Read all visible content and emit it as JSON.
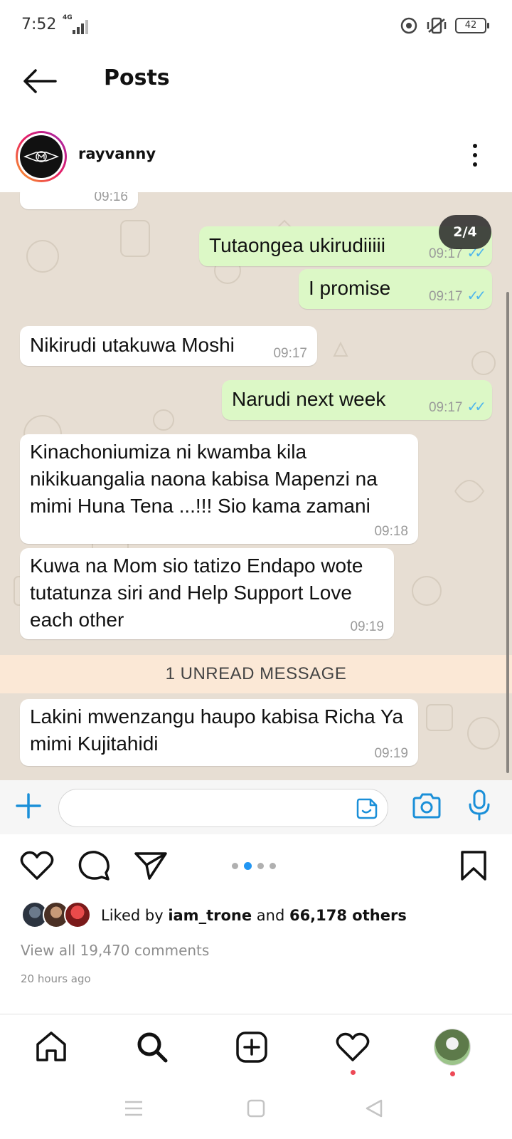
{
  "status_bar": {
    "time": "7:52",
    "network": "4G",
    "battery": "42"
  },
  "header": {
    "title": "Posts"
  },
  "post": {
    "username": "rayvanny",
    "image_counter": "2/4",
    "current_image": 2,
    "total_images": 4
  },
  "chat": {
    "top_partial_time": "09:16",
    "messages": [
      {
        "direction": "out",
        "text": "Tutaongea ukirudiiiii",
        "time": "09:17",
        "ticks": "✓✓"
      },
      {
        "direction": "out",
        "text": "I promise",
        "time": "09:17",
        "ticks": "✓✓"
      },
      {
        "direction": "in",
        "text": "Nikirudi utakuwa Moshi",
        "time": "09:17"
      },
      {
        "direction": "out",
        "text": "Narudi next week",
        "time": "09:17",
        "ticks": "✓✓"
      },
      {
        "direction": "in",
        "text": "Kinachoniumiza ni kwamba kila nikikuangalia naona kabisa Mapenzi na mimi Huna Tena ...!!! Sio kama zamani",
        "time": "09:18"
      },
      {
        "direction": "in",
        "text": "Kuwa na Mom sio tatizo Endapo wote tutatunza siri and Help Support Love each other",
        "time": "09:19"
      },
      {
        "direction": "in",
        "text": "Lakini mwenzangu haupo  kabisa Richa Ya mimi Kujitahidi",
        "time": "09:19"
      }
    ],
    "unread_banner": "1 UNREAD MESSAGE"
  },
  "likes": {
    "prefix": "Liked by ",
    "user": "iam_trone",
    "middle": " and ",
    "others": "66,178 others"
  },
  "comments_link": "View all 19,470 comments",
  "posted_time": "20 hours ago",
  "colors": {
    "chat_bg": "#e7ded3",
    "outgoing_bubble": "#dcf8c6",
    "incoming_bubble": "#ffffff",
    "tick_blue": "#4fb6ec",
    "unread_banner": "#fbe8d6",
    "dot_active": "#2196f3",
    "notification_red": "#ed4956"
  }
}
